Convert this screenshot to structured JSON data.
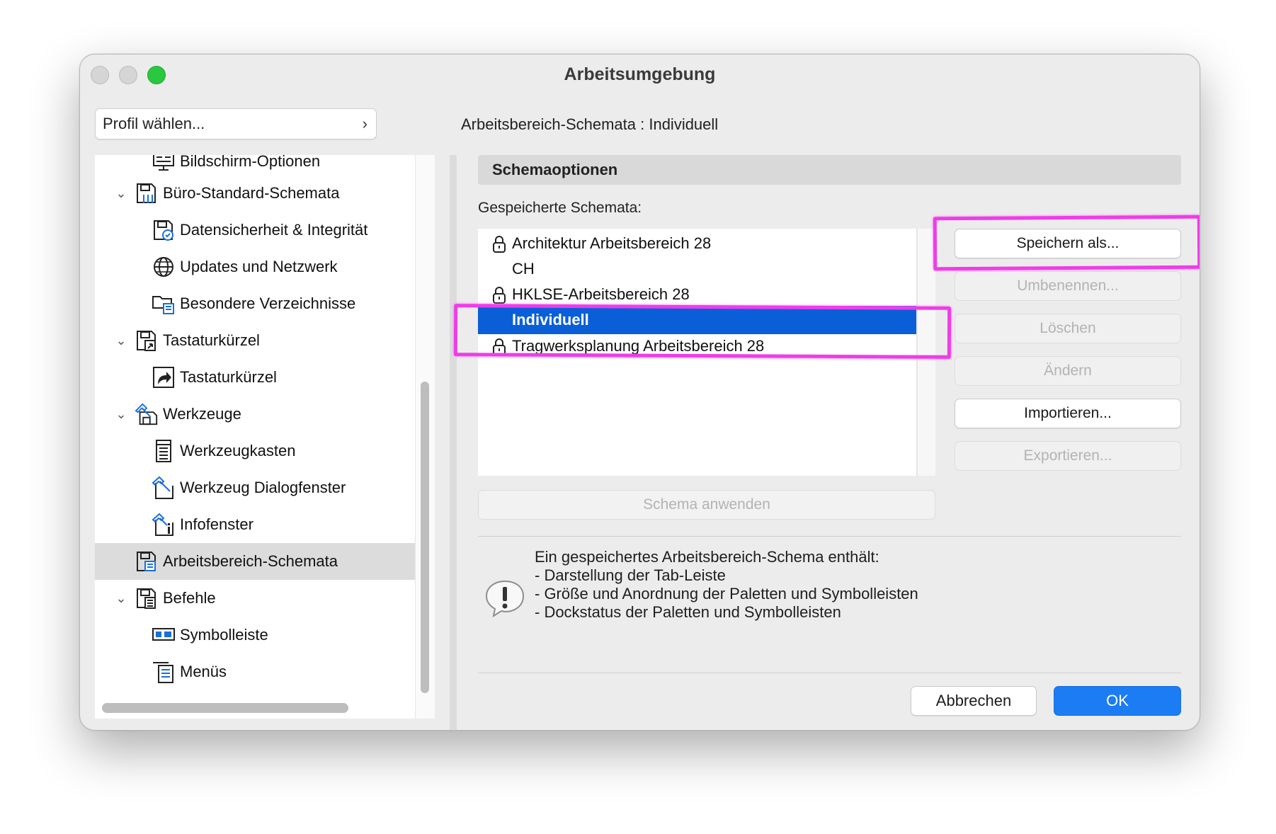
{
  "window": {
    "title": "Arbeitsumgebung"
  },
  "profile": {
    "label": "Profil wählen...",
    "chevron": "›"
  },
  "tree": {
    "items": [
      {
        "label": "Bildschirm-Optionen",
        "icon": "monitor-options-icon"
      },
      {
        "label": "Büro-Standard-Schemata",
        "icon": "office-schemes-icon",
        "expanded": true
      },
      {
        "label": "Datensicherheit & Integrität",
        "icon": "data-safety-icon"
      },
      {
        "label": "Updates und Netzwerk",
        "icon": "globe-icon"
      },
      {
        "label": "Besondere Verzeichnisse",
        "icon": "folders-icon"
      },
      {
        "label": "Tastaturkürzel",
        "icon": "keyboard-schemes-icon",
        "expanded": true
      },
      {
        "label": "Tastaturkürzel",
        "icon": "shortcut-arrow-icon"
      },
      {
        "label": "Werkzeuge",
        "icon": "tools-schemes-icon",
        "expanded": true
      },
      {
        "label": "Werkzeugkasten",
        "icon": "toolbox-icon"
      },
      {
        "label": "Werkzeug Dialogfenster",
        "icon": "tool-dialog-icon"
      },
      {
        "label": "Infofenster",
        "icon": "info-box-icon"
      },
      {
        "label": "Arbeitsbereich-Schemata",
        "icon": "workspace-schemes-icon",
        "selected": true
      },
      {
        "label": "Befehle",
        "icon": "commands-icon",
        "expanded": true
      },
      {
        "label": "Symbolleiste",
        "icon": "toolbar-icon"
      },
      {
        "label": "Menüs",
        "icon": "menus-icon"
      }
    ]
  },
  "header": {
    "text": "Arbeitsbereich-Schemata : Individuell"
  },
  "section": {
    "title": "Schemaoptionen"
  },
  "saved": {
    "label": "Gespeicherte Schemata:"
  },
  "schemes": [
    {
      "label": "Architektur Arbeitsbereich 28",
      "locked": true
    },
    {
      "label": "CH",
      "locked": false
    },
    {
      "label": "HKLSE-Arbeitsbereich 28",
      "locked": true
    },
    {
      "label": "Individuell",
      "locked": false,
      "selected": true
    },
    {
      "label": "Tragwerksplanung Arbeitsbereich 28",
      "locked": true
    }
  ],
  "buttons": {
    "save_as": "Speichern als...",
    "rename": "Umbenennen...",
    "delete": "Löschen",
    "change": "Ändern",
    "import": "Importieren...",
    "export": "Exportieren...",
    "apply": "Schema anwenden",
    "cancel": "Abbrechen",
    "ok": "OK"
  },
  "info": {
    "lines": [
      "Ein gespeichertes Arbeitsbereich-Schema enthält:",
      "- Darstellung der Tab-Leiste",
      "- Größe und Anordnung der Paletten und Symbolleisten",
      "- Dockstatus der Paletten und Symbolleisten"
    ]
  },
  "colors": {
    "selection": "#0a5fd8",
    "ok_button": "#1b7cf4",
    "highlight": "#ee3de8"
  }
}
